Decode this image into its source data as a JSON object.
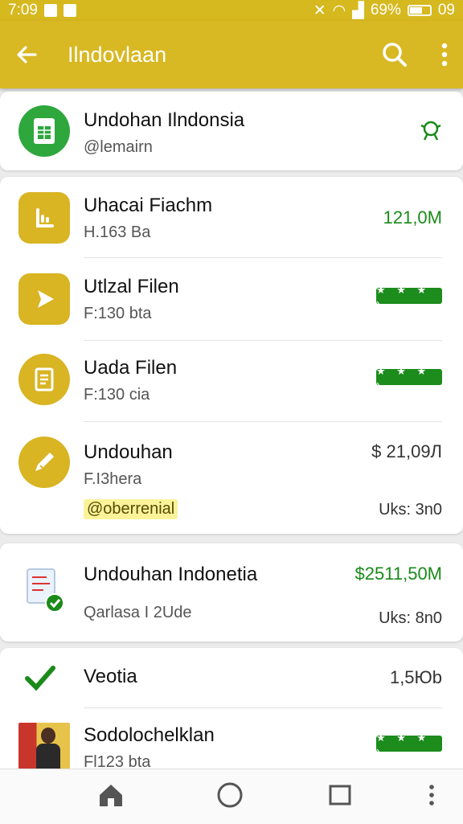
{
  "status_bar": {
    "time": "7:09",
    "battery": "69%",
    "right_text": "09"
  },
  "app_bar": {
    "title": "Ilndovlaan"
  },
  "header_card": {
    "name": "Undohan Ilndonsia",
    "sub": "@lemairn"
  },
  "list": [
    {
      "name": "Uhacai Fiachm",
      "sub": "H.163 Ba",
      "value": "121,0M",
      "kind": "value-green"
    },
    {
      "name": "Utlzal Filen",
      "sub": "F:130 bta",
      "kind": "stars"
    },
    {
      "name": "Uada Filen",
      "sub": "F:130 cia",
      "kind": "stars"
    },
    {
      "name": "Undouhan",
      "sub": "F.I3hera",
      "value": "$ 21,09Л",
      "tag": "@oberrenial",
      "extra": "Uks: 3n0",
      "kind": "value-dark"
    }
  ],
  "card2": {
    "name": "Undouhan Indonetia",
    "value": "$2511,50M",
    "sub": "Qarlasa I 2Ude",
    "extra": "Uks: 8n0"
  },
  "card3": [
    {
      "name": "Veotia",
      "value": "1,5Юb"
    },
    {
      "name": "Sodolochelklan",
      "sub": "Fl123 bta",
      "kind": "stars"
    }
  ],
  "stars_label": "★ ★ ★ ›",
  "colors": {
    "accent": "#d8b823",
    "green": "#1a8a1a"
  },
  "icons": [
    "back-arrow-icon",
    "search-icon",
    "more-vert-icon",
    "home-icon",
    "circle-home-icon",
    "square-recents-icon"
  ]
}
